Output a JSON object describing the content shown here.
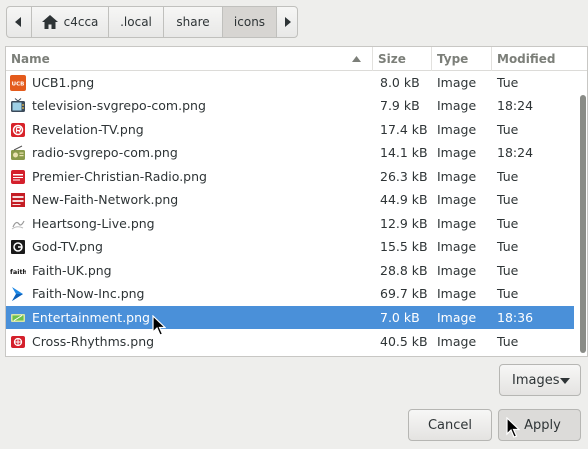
{
  "pathbar": {
    "segments": [
      {
        "label": "c4cca"
      },
      {
        "label": ".local"
      },
      {
        "label": "share"
      },
      {
        "label": "icons"
      }
    ]
  },
  "columns": {
    "name": "Name",
    "size": "Size",
    "type": "Type",
    "modified": "Modified"
  },
  "files": [
    {
      "name": "UCB1.png",
      "size": "8.0 kB",
      "type": "Image",
      "modified": "Tue",
      "icon": "ucb1-icon"
    },
    {
      "name": "television-svgrepo-com.png",
      "size": "7.9 kB",
      "type": "Image",
      "modified": "18:24",
      "icon": "television-icon"
    },
    {
      "name": "Revelation-TV.png",
      "size": "17.4 kB",
      "type": "Image",
      "modified": "Tue",
      "icon": "revelation-tv-icon"
    },
    {
      "name": "radio-svgrepo-com.png",
      "size": "14.1 kB",
      "type": "Image",
      "modified": "18:24",
      "icon": "radio-icon"
    },
    {
      "name": "Premier-Christian-Radio.png",
      "size": "26.3 kB",
      "type": "Image",
      "modified": "Tue",
      "icon": "premier-radio-icon"
    },
    {
      "name": "New-Faith-Network.png",
      "size": "44.9 kB",
      "type": "Image",
      "modified": "Tue",
      "icon": "new-faith-icon"
    },
    {
      "name": "Heartsong-Live.png",
      "size": "12.9 kB",
      "type": "Image",
      "modified": "Tue",
      "icon": "heartsong-icon"
    },
    {
      "name": "God-TV.png",
      "size": "15.5 kB",
      "type": "Image",
      "modified": "Tue",
      "icon": "god-tv-icon"
    },
    {
      "name": "Faith-UK.png",
      "size": "28.8 kB",
      "type": "Image",
      "modified": "Tue",
      "icon": "faith-uk-icon"
    },
    {
      "name": "Faith-Now-Inc.png",
      "size": "69.7 kB",
      "type": "Image",
      "modified": "Tue",
      "icon": "faith-now-icon"
    },
    {
      "name": "Entertainment.png",
      "size": "7.0 kB",
      "type": "Image",
      "modified": "18:36",
      "icon": "entertainment-icon",
      "selected": true
    },
    {
      "name": "Cross-Rhythms.png",
      "size": "40.5 kB",
      "type": "Image",
      "modified": "Tue",
      "icon": "cross-rhythms-icon"
    }
  ],
  "filter": {
    "label": "Images"
  },
  "actions": {
    "cancel": "Cancel",
    "apply": "Apply"
  },
  "colors": {
    "selection": "#4a90d9",
    "background": "#eeeeec"
  },
  "faith_uk_logo_text": "faith."
}
